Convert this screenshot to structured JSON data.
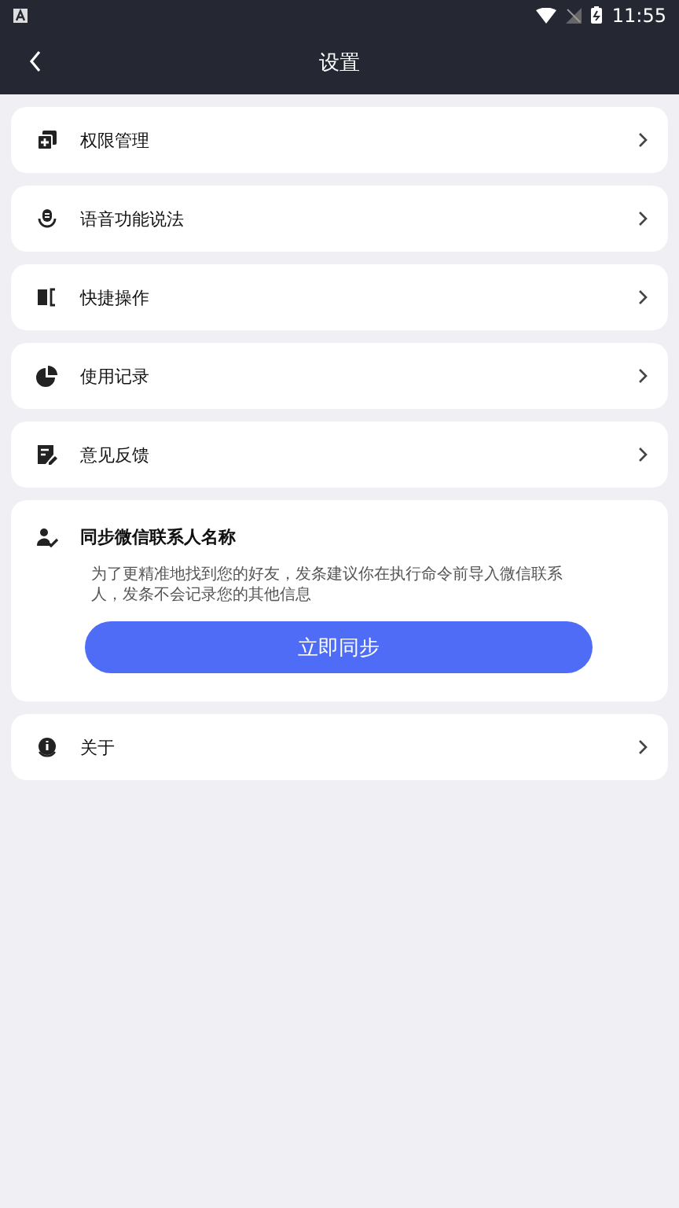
{
  "status_bar": {
    "time": "11:55"
  },
  "header": {
    "title": "设置"
  },
  "menu_items": [
    {
      "label": "权限管理"
    },
    {
      "label": "语音功能说法"
    },
    {
      "label": "快捷操作"
    },
    {
      "label": "使用记录"
    },
    {
      "label": "意见反馈"
    }
  ],
  "sync_card": {
    "title": "同步微信联系人名称",
    "description": "为了更精准地找到您的好友，发条建议你在执行命令前导入微信联系人，发条不会记录您的其他信息",
    "button": "立即同步"
  },
  "about_item": {
    "label": "关于"
  }
}
